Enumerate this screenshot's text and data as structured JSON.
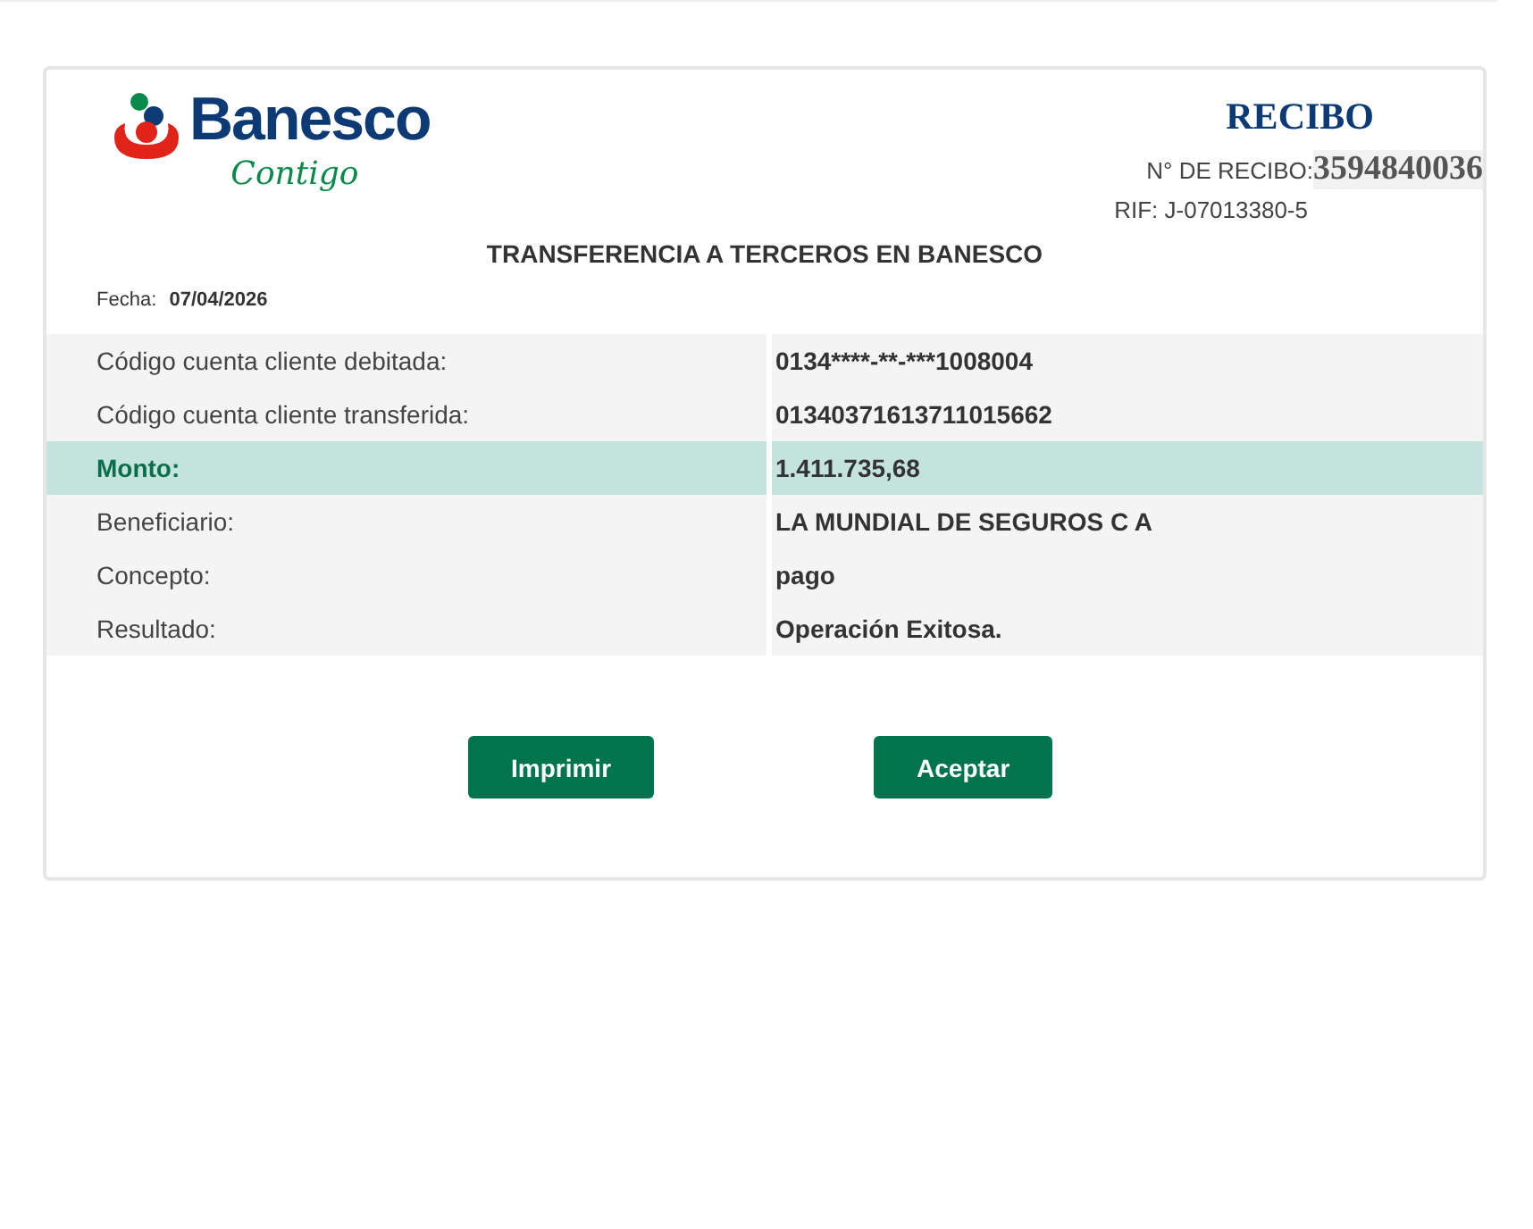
{
  "logo": {
    "name": "Banesco",
    "tagline": "Contigo"
  },
  "receipt": {
    "title": "RECIBO",
    "number_label": "N° DE RECIBO:",
    "number": "3594840036",
    "rif": "RIF: J-07013380-5"
  },
  "heading": "TRANSFERENCIA A TERCEROS EN BANESCO",
  "date": {
    "label": "Fecha:",
    "value": "07/04/2026"
  },
  "rows": [
    {
      "label": "Código cuenta cliente debitada:",
      "value": "0134****-**-***1008004",
      "highlighted": false
    },
    {
      "label": "Código cuenta cliente transferida:",
      "value": "01340371613711015662",
      "highlighted": false
    },
    {
      "label": "Monto:",
      "value": "1.411.735,68",
      "highlighted": true
    },
    {
      "label": "Beneficiario:",
      "value": "LA MUNDIAL DE SEGUROS C A",
      "highlighted": false
    },
    {
      "label": "Concepto:",
      "value": "pago",
      "highlighted": false
    },
    {
      "label": "Resultado:",
      "value": "Operación Exitosa.",
      "highlighted": false
    }
  ],
  "buttons": [
    "Imprimir",
    "Aceptar"
  ]
}
